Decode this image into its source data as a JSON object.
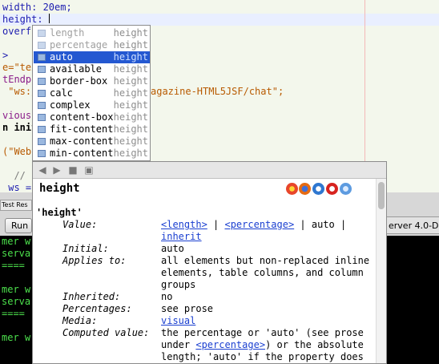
{
  "editor": {
    "lines": [
      {
        "text": "width: 20em;"
      },
      {
        "text": "height: "
      },
      {
        "text": "overf"
      },
      {
        "text": ""
      },
      {
        "text": ">"
      },
      {
        "text": "e=\"tex"
      },
      {
        "text": "tEndpo"
      },
      {
        "text": " \"ws:/",
        "tail": "agazine-HTML5JSF/chat\";"
      },
      {
        "text": ""
      },
      {
        "text": "vious;"
      },
      {
        "text": "n initi"
      },
      {
        "text": ""
      },
      {
        "text": "(\"WebSo"
      },
      {
        "text": ""
      },
      {
        "text": "  // Le"
      },
      {
        "text": " ws = "
      }
    ]
  },
  "completion": {
    "items": [
      {
        "label": "length",
        "kind": "height",
        "state": "dim"
      },
      {
        "label": "percentage",
        "kind": "height",
        "state": "dim"
      },
      {
        "label": "auto",
        "kind": "height",
        "state": "selected"
      },
      {
        "label": "available",
        "kind": "height",
        "state": "normal"
      },
      {
        "label": "border-box",
        "kind": "height",
        "state": "normal"
      },
      {
        "label": "calc",
        "kind": "height",
        "state": "normal"
      },
      {
        "label": "complex",
        "kind": "height",
        "state": "normal"
      },
      {
        "label": "content-box",
        "kind": "height",
        "state": "normal"
      },
      {
        "label": "fit-content",
        "kind": "height",
        "state": "normal"
      },
      {
        "label": "max-content",
        "kind": "height",
        "state": "normal"
      },
      {
        "label": "min-content",
        "kind": "height",
        "state": "normal"
      }
    ]
  },
  "bottom": {
    "tab_label": "Test Res",
    "run_label": "Run",
    "server_label": "erver 4.0-D",
    "console_lines": [
      "mer w",
      "serva",
      "====",
      "",
      "mer w",
      "serva",
      "====",
      "",
      "mer w"
    ]
  },
  "doc": {
    "toolbar_icons": [
      "back-icon",
      "forward-icon",
      "stop-icon",
      "open-in-browser-icon"
    ],
    "title": "height",
    "prop_name": "'height'",
    "browser_icons": [
      {
        "name": "chrome-icon",
        "color": "#e8462b"
      },
      {
        "name": "firefox-icon",
        "color": "#e66b12"
      },
      {
        "name": "ie-icon",
        "color": "#2f77d0"
      },
      {
        "name": "opera-icon",
        "color": "#d7231f"
      },
      {
        "name": "safari-icon",
        "color": "#5d9be0"
      }
    ],
    "value_label": "Value:",
    "value_parts": {
      "length": "<length>",
      "sep1": " | ",
      "percentage": "<percentage>",
      "sep2": " | auto |",
      "inherit": "inherit"
    },
    "rows": [
      {
        "label": "Initial:",
        "value": "auto"
      },
      {
        "label": "Applies to:",
        "value": "all elements but non-replaced inline elements, table columns, and column groups"
      },
      {
        "label": "Inherited:",
        "value": "no"
      },
      {
        "label": "Percentages:",
        "value": "see prose"
      },
      {
        "label": "Media:",
        "value": "visual"
      }
    ],
    "computed_label": "Computed value:",
    "computed_parts": {
      "a": "the percentage or 'auto' (see prose under ",
      "link": "<percentage>",
      "b": ") or the absolute length; 'auto' if the property does"
    }
  }
}
